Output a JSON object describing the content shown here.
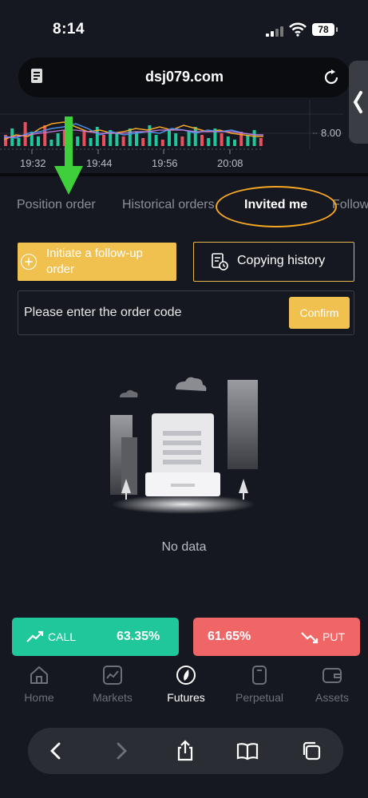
{
  "status_bar": {
    "time": "8:14",
    "battery": "78"
  },
  "browser": {
    "url": "dsj079.com"
  },
  "chart_data": {
    "type": "line",
    "x_ticks": [
      "19:32",
      "19:44",
      "19:56",
      "20:08"
    ],
    "y_ticks": [
      "8.00"
    ],
    "grid": true
  },
  "tabs": [
    {
      "label": "Position order",
      "active": false
    },
    {
      "label": "Historical orders",
      "active": false
    },
    {
      "label": "Invited me",
      "active": true
    },
    {
      "label": "Follow",
      "active": false
    }
  ],
  "actions": {
    "follow_label": "Initiate a follow-up order",
    "history_label": "Copying history"
  },
  "order_code": {
    "placeholder": "Please enter the order code",
    "confirm_label": "Confirm"
  },
  "empty_state": {
    "text": "No data"
  },
  "trade": {
    "call_label": "CALL",
    "call_pct": "63.35%",
    "put_label": "PUT",
    "put_pct": "61.65%",
    "call_color": "#1fc79a",
    "put_color": "#f06667"
  },
  "nav": [
    {
      "label": "Home",
      "icon": "home-icon"
    },
    {
      "label": "Markets",
      "icon": "markets-icon"
    },
    {
      "label": "Futures",
      "icon": "futures-icon",
      "active": true
    },
    {
      "label": "Perpetual",
      "icon": "perpetual-icon"
    },
    {
      "label": "Assets",
      "icon": "wallet-icon"
    }
  ],
  "colors": {
    "accent": "#f0c14f",
    "background": "#151820",
    "annotation_ring": "#f5a623",
    "annotation_arrow": "#3ecf3a"
  }
}
